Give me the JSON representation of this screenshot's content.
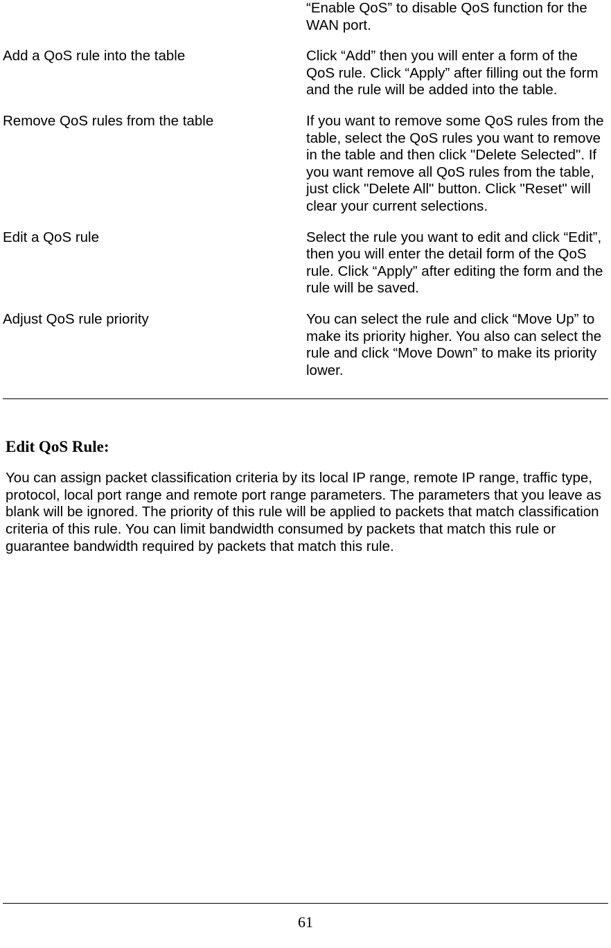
{
  "rows": [
    {
      "label": "",
      "desc": "“Enable QoS” to disable QoS function for the WAN port."
    },
    {
      "label": "Add a QoS rule into the table",
      "desc": "Click “Add” then you will enter a form of the QoS rule. Click “Apply” after filling out the form and the rule will be added into the table."
    },
    {
      "label": "Remove QoS rules from the table",
      "desc": "If you want to remove some QoS rules from the table, select the QoS rules you want to remove in the table and then click \"Delete Selected\". If you want remove all QoS rules from the table, just click \"Delete All\" button. Click \"Reset\" will clear your current selections."
    },
    {
      "label": "Edit a QoS rule",
      "desc": "Select the rule you want to edit and click “Edit”, then you will enter the detail form of the QoS rule. Click “Apply” after editing the form and the rule will be saved."
    },
    {
      "label": "Adjust QoS rule priority",
      "desc": "You can select the rule and click “Move Up” to make its priority higher. You also can select the rule and click “Move Down” to make its priority lower."
    }
  ],
  "section": {
    "heading": "Edit QoS Rule:",
    "paragraph": "You can assign packet classification criteria by its local IP range, remote IP range, traffic type, protocol, local port range and remote port range parameters. The parameters that you leave as blank will be ignored. The priority of this rule will be applied to packets that match classification criteria of this rule. You can limit bandwidth consumed by packets that match this rule or guarantee bandwidth required by packets that match this rule."
  },
  "page_number": "61"
}
